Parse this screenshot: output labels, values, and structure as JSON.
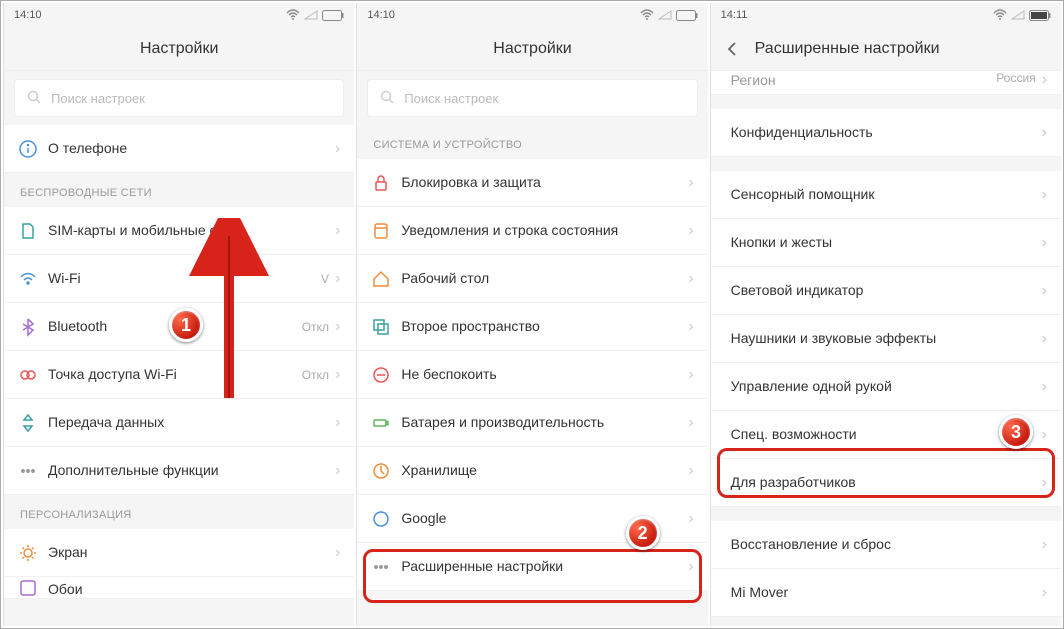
{
  "status": {
    "time": "14:10",
    "time3": "14:11"
  },
  "screen1": {
    "title": "Настройки",
    "search_placeholder": "Поиск настроек",
    "about": "О телефоне",
    "section_wireless": "БЕСПРОВОДНЫЕ СЕТИ",
    "items": {
      "sim": "SIM-карты и мобильные сети",
      "wifi": "Wi-Fi",
      "wifi_val": "V",
      "bt": "Bluetooth",
      "bt_val": "Откл",
      "hotspot": "Точка доступа Wi-Fi",
      "hotspot_val": "Откл",
      "data": "Передача данных",
      "more": "Дополнительные функции"
    },
    "section_personal": "ПЕРСОНАЛИЗАЦИЯ",
    "display": "Экран",
    "wallpaper": "Обои"
  },
  "screen2": {
    "title": "Настройки",
    "search_placeholder": "Поиск настроек",
    "section_system": "СИСТЕМА И УСТРОЙСТВО",
    "items": {
      "lock": "Блокировка и защита",
      "notif": "Уведомления и строка состояния",
      "home": "Рабочий стол",
      "second": "Второе пространство",
      "dnd": "Не беспокоить",
      "battery": "Батарея и производительность",
      "storage": "Хранилище",
      "google": "Google",
      "advanced": "Расширенные настройки"
    }
  },
  "screen3": {
    "title": "Расширенные настройки",
    "region_label": "Регион",
    "region_val": "Россия",
    "items": {
      "privacy": "Конфиденциальность",
      "assist": "Сенсорный помощник",
      "buttons": "Кнопки и жесты",
      "led": "Световой индикатор",
      "audio": "Наушники и звуковые эффекты",
      "onehand": "Управление одной рукой",
      "a11y": "Спец. возможности",
      "dev": "Для разработчиков",
      "reset": "Восстановление и сброс",
      "mimover": "Mi Mover"
    }
  },
  "badges": {
    "b1": "1",
    "b2": "2",
    "b3": "3"
  }
}
